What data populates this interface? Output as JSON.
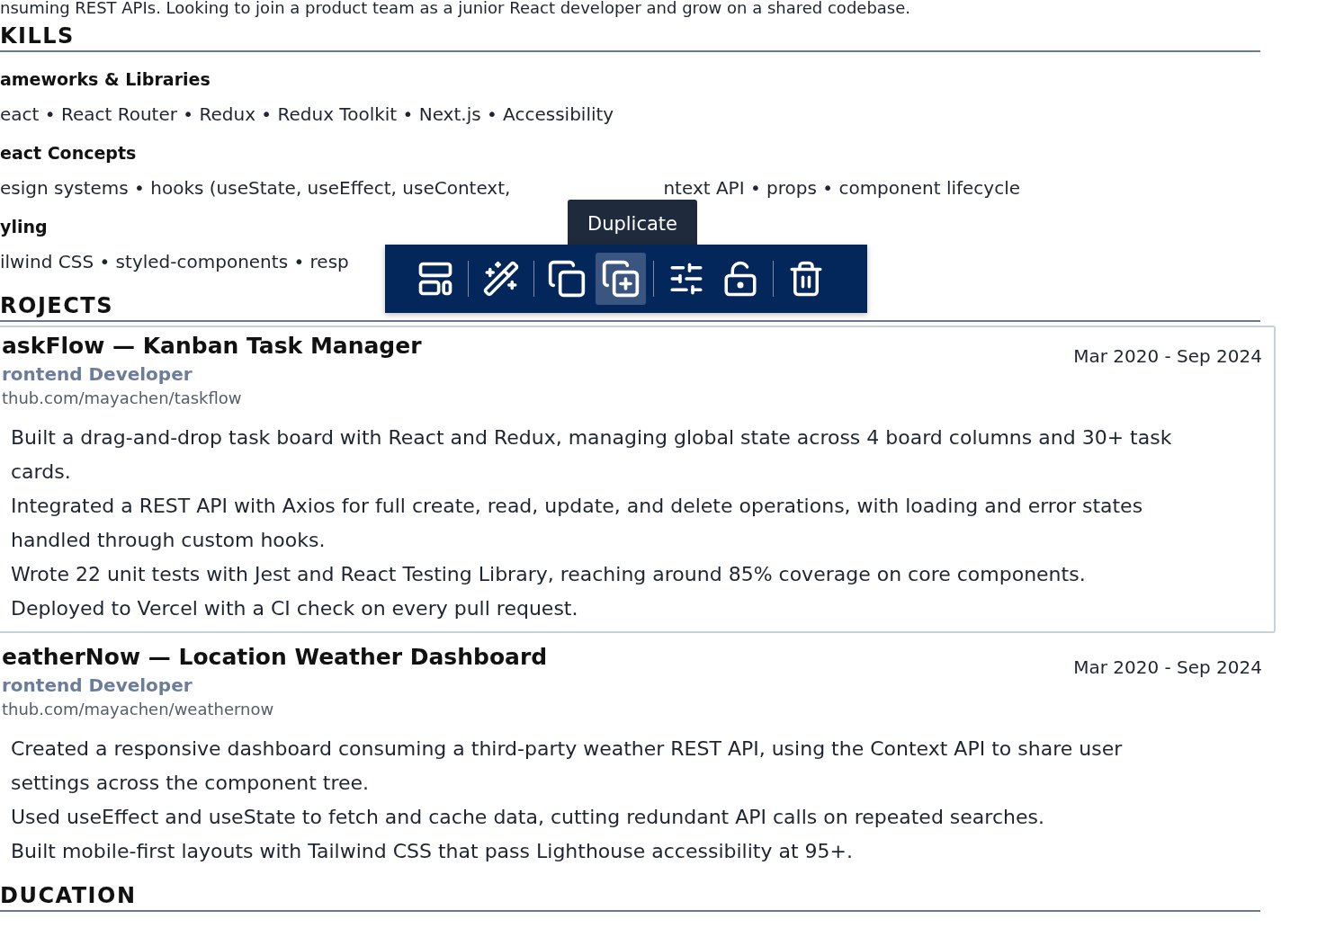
{
  "summary_tail": "nsuming REST APIs. Looking to join a product team as a junior React developer and grow on a shared codebase.",
  "skills": {
    "heading": "KILLS",
    "groups": [
      {
        "title": "ameworks & Libraries",
        "segments": [
          "eact • React Router • Redux • Redux Toolkit • Next.js • Accessibility"
        ]
      },
      {
        "title": "eact Concepts",
        "segments": [
          "esign systems • hooks (useState, useEffect, useContext,",
          "ntext API • props • component lifecycle"
        ]
      },
      {
        "title": "yling",
        "segments": [
          "ilwind CSS • styled-components • resp"
        ]
      }
    ]
  },
  "tooltip": "Duplicate",
  "toolbar": [
    {
      "kind": "layout",
      "selected": false
    },
    {
      "kind": "magic",
      "selected": false
    },
    {
      "kind": "copy",
      "selected": false
    },
    {
      "kind": "duplicate",
      "selected": true
    },
    {
      "kind": "sliders",
      "selected": false
    },
    {
      "kind": "unlock",
      "selected": false
    },
    {
      "kind": "delete",
      "selected": false
    }
  ],
  "projects": {
    "heading": "ROJECTS",
    "items": [
      {
        "title": "askFlow — Kanban Task Manager",
        "role": "rontend Developer",
        "link": "thub.com/mayachen/taskflow",
        "dates": "Mar 2020 - Sep 2024",
        "highlighted": true,
        "bullets": [
          "Built a drag-and-drop task board with React and Redux, managing global state across 4 board columns and 30+ task cards.",
          "Integrated a REST API with Axios for full create, read, update, and delete operations, with loading and error states handled through custom hooks.",
          "Wrote 22 unit tests with Jest and React Testing Library, reaching around 85% coverage on core components.",
          "Deployed to Vercel with a CI check on every pull request."
        ]
      },
      {
        "title": "eatherNow — Location Weather Dashboard",
        "role": "rontend Developer",
        "link": "thub.com/mayachen/weathernow",
        "dates": "Mar 2020 - Sep 2024",
        "highlighted": false,
        "bullets": [
          "Created a responsive dashboard consuming a third-party weather REST API, using the Context API to share user settings across the component tree.",
          "Used useEffect and useState to fetch and cache data, cutting redundant API calls on repeated searches.",
          "Built mobile-first layouts with Tailwind CSS that pass Lighthouse accessibility at 95+."
        ]
      }
    ]
  },
  "education": {
    "heading": "DUCATION"
  }
}
